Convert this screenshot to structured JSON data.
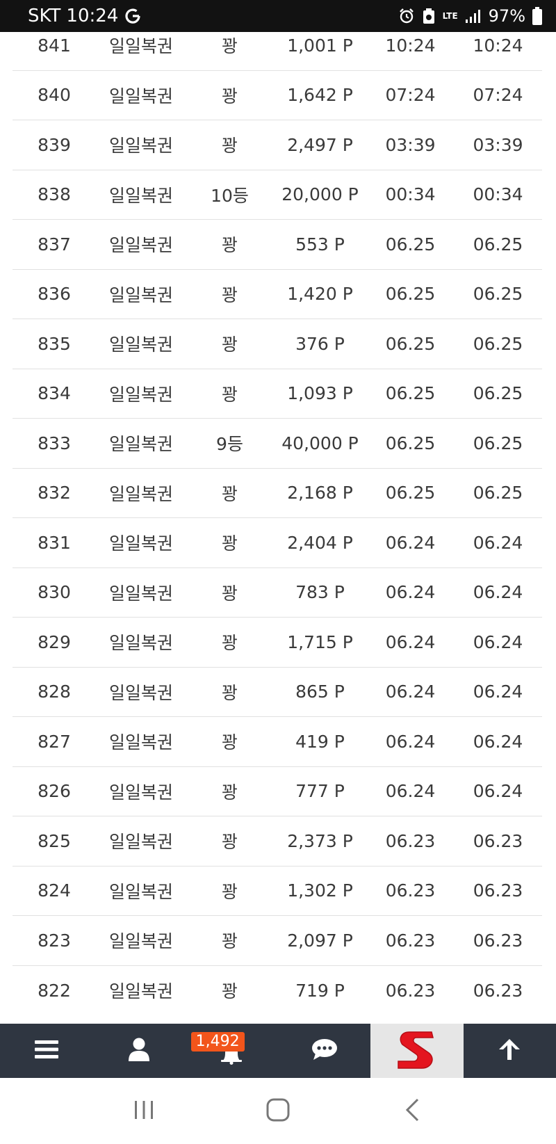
{
  "status_bar": {
    "carrier": "SKT",
    "time": "10:24",
    "network": "LTE",
    "battery": "97%"
  },
  "rows": [
    {
      "num": "841",
      "name": "일일복권",
      "result": "꽝",
      "points": "1,001 P",
      "time1": "10:24",
      "time2": "10:24"
    },
    {
      "num": "840",
      "name": "일일복권",
      "result": "꽝",
      "points": "1,642 P",
      "time1": "07:24",
      "time2": "07:24"
    },
    {
      "num": "839",
      "name": "일일복권",
      "result": "꽝",
      "points": "2,497 P",
      "time1": "03:39",
      "time2": "03:39"
    },
    {
      "num": "838",
      "name": "일일복권",
      "result": "10등",
      "points": "20,000 P",
      "time1": "00:34",
      "time2": "00:34"
    },
    {
      "num": "837",
      "name": "일일복권",
      "result": "꽝",
      "points": "553 P",
      "time1": "06.25",
      "time2": "06.25"
    },
    {
      "num": "836",
      "name": "일일복권",
      "result": "꽝",
      "points": "1,420 P",
      "time1": "06.25",
      "time2": "06.25"
    },
    {
      "num": "835",
      "name": "일일복권",
      "result": "꽝",
      "points": "376 P",
      "time1": "06.25",
      "time2": "06.25"
    },
    {
      "num": "834",
      "name": "일일복권",
      "result": "꽝",
      "points": "1,093 P",
      "time1": "06.25",
      "time2": "06.25"
    },
    {
      "num": "833",
      "name": "일일복권",
      "result": "9등",
      "points": "40,000 P",
      "time1": "06.25",
      "time2": "06.25"
    },
    {
      "num": "832",
      "name": "일일복권",
      "result": "꽝",
      "points": "2,168 P",
      "time1": "06.25",
      "time2": "06.25"
    },
    {
      "num": "831",
      "name": "일일복권",
      "result": "꽝",
      "points": "2,404 P",
      "time1": "06.24",
      "time2": "06.24"
    },
    {
      "num": "830",
      "name": "일일복권",
      "result": "꽝",
      "points": "783 P",
      "time1": "06.24",
      "time2": "06.24"
    },
    {
      "num": "829",
      "name": "일일복권",
      "result": "꽝",
      "points": "1,715 P",
      "time1": "06.24",
      "time2": "06.24"
    },
    {
      "num": "828",
      "name": "일일복권",
      "result": "꽝",
      "points": "865 P",
      "time1": "06.24",
      "time2": "06.24"
    },
    {
      "num": "827",
      "name": "일일복권",
      "result": "꽝",
      "points": "419 P",
      "time1": "06.24",
      "time2": "06.24"
    },
    {
      "num": "826",
      "name": "일일복권",
      "result": "꽝",
      "points": "777 P",
      "time1": "06.24",
      "time2": "06.24"
    },
    {
      "num": "825",
      "name": "일일복권",
      "result": "꽝",
      "points": "2,373 P",
      "time1": "06.23",
      "time2": "06.23"
    },
    {
      "num": "824",
      "name": "일일복권",
      "result": "꽝",
      "points": "1,302 P",
      "time1": "06.23",
      "time2": "06.23"
    },
    {
      "num": "823",
      "name": "일일복권",
      "result": "꽝",
      "points": "2,097 P",
      "time1": "06.23",
      "time2": "06.23"
    },
    {
      "num": "822",
      "name": "일일복권",
      "result": "꽝",
      "points": "719 P",
      "time1": "06.23",
      "time2": "06.23"
    }
  ],
  "toolbar": {
    "items": [
      "menu-icon",
      "user-icon",
      "bell-icon",
      "chat-icon",
      "site-logo",
      "arrow-up-icon"
    ],
    "notification_count": "1,492",
    "logo_color": "#e4151f",
    "background": "#2f3641"
  },
  "navbar": {
    "items": [
      "recent-apps-icon",
      "home-icon",
      "back-icon"
    ]
  }
}
